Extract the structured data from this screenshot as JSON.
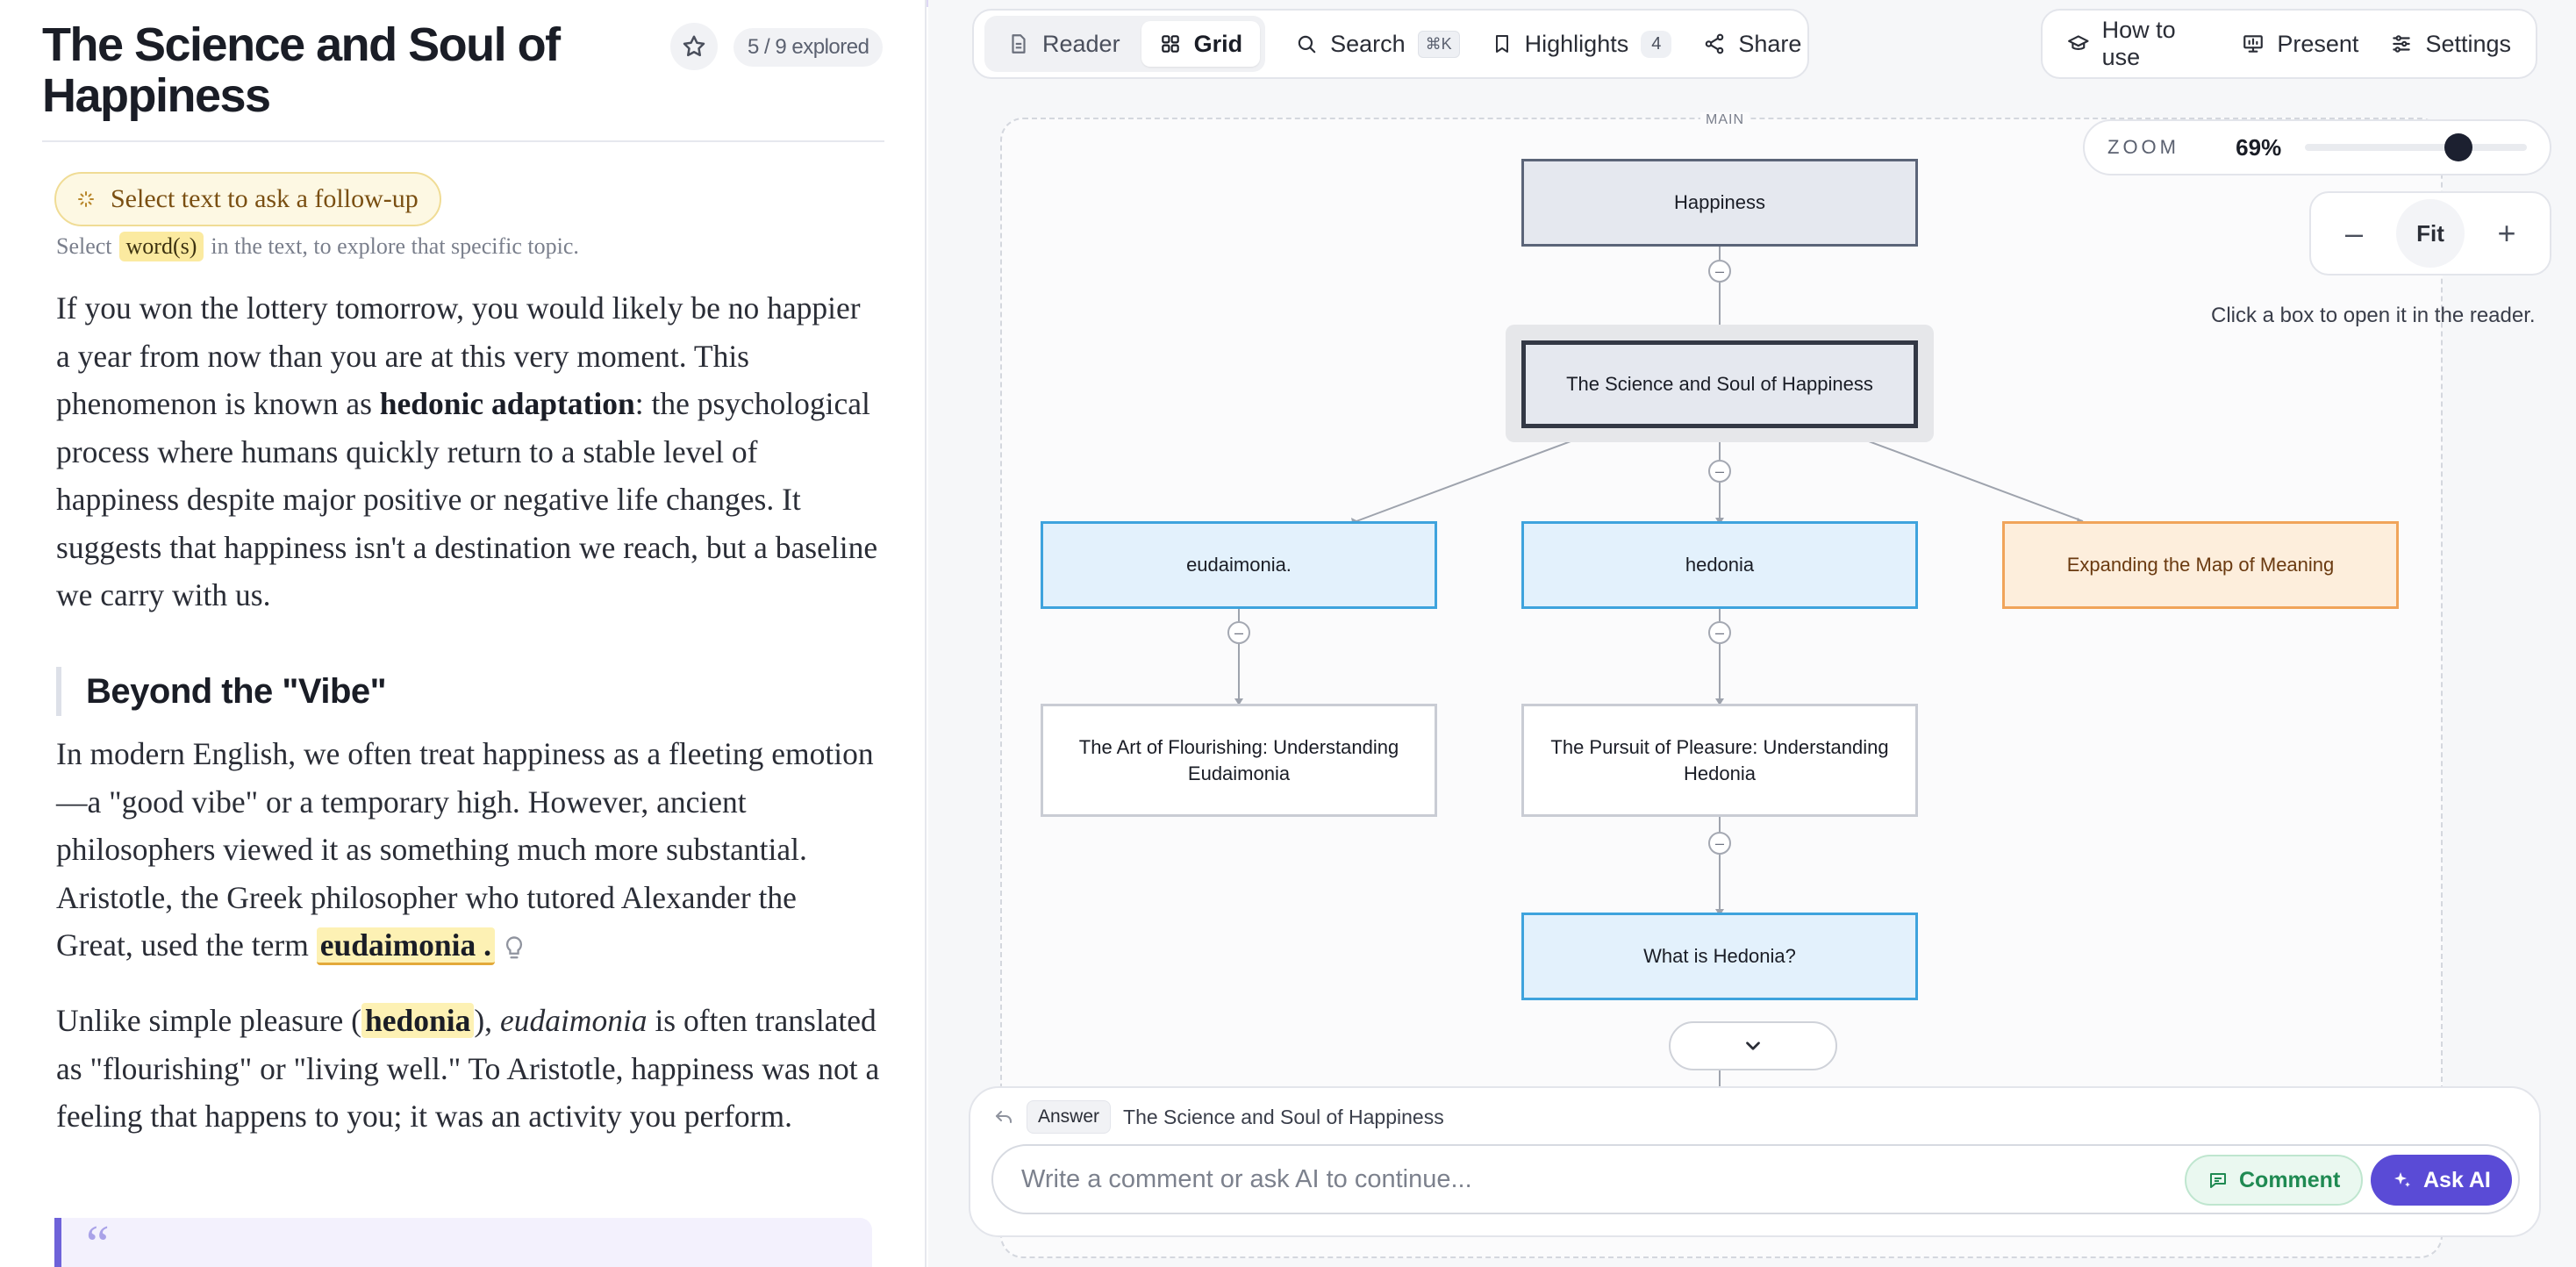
{
  "document": {
    "title": "The Science and Soul of Happiness",
    "explored": "5 / 9 explored"
  },
  "followup": {
    "pill_label": "Select text to ask a follow-up",
    "hint_before": "Select",
    "hint_chip": "word(s)",
    "hint_after": "in the text, to explore that specific topic."
  },
  "content": {
    "p1_a": "If you won the lottery tomorrow, you would likely be no happier a year from now than you are at this very moment. This phenomenon is known as ",
    "p1_bold": "hedonic adaptation",
    "p1_b": ": the psychological process where humans quickly return to a stable level of happiness despite major positive or negative life changes. It suggests that happiness isn't a destination we reach, but a baseline we carry with us.",
    "h2": "Beyond the \"Vibe\"",
    "p2_a": "In modern English, we often treat happiness as a fleeting emotion—a \"good vibe\" or a temporary high. However, ancient philosophers viewed it as something much more substantial. Aristotle, the Greek philosopher who tutored Alexander the Great, used the term ",
    "p2_term": "eudaimonia",
    "p2_b": ".",
    "p3_a": "Unlike simple pleasure (",
    "p3_term": "hedonia",
    "p3_b": "), ",
    "p3_ital": "eudaimonia",
    "p3_c": " is often translated as \"flourishing\" or \"living well.\" To Aristotle, happiness was not a feeling that happens to you; it was an activity you perform.",
    "quote_mark": "“"
  },
  "toolbar": {
    "reader": "Reader",
    "grid": "Grid",
    "search": "Search",
    "search_kbd": "⌘K",
    "highlights": "Highlights",
    "highlights_count": "4",
    "share": "Share",
    "how_to_use": "How to use",
    "present": "Present",
    "settings": "Settings"
  },
  "canvas": {
    "label": "MAIN",
    "hint": "Click a box to open it in the reader.",
    "nodes": {
      "root": "Happiness",
      "main": "The Science and Soul of Happiness",
      "eud": "eudaimonia.",
      "hed": "hedonia",
      "map": "Expanding the Map of Meaning",
      "art": "The Art of Flourishing: Understanding Eudaimonia",
      "pursuit": "The Pursuit of Pleasure: Understanding Hedonia",
      "what": "What is Hedonia?"
    }
  },
  "zoom": {
    "label": "ZOOM",
    "value": "69%",
    "level": 0.69,
    "fit": "Fit"
  },
  "composer": {
    "context_tag": "Answer",
    "context_text": "The Science and Soul of Happiness",
    "placeholder": "Write a comment or ask AI to continue...",
    "comment": "Comment",
    "ask_ai": "Ask AI"
  },
  "colors": {
    "accent": "#5a4bd6",
    "node_blue": "#3ea3dd",
    "node_orange": "#f0a45a",
    "highlight": "#fdf1b4"
  }
}
